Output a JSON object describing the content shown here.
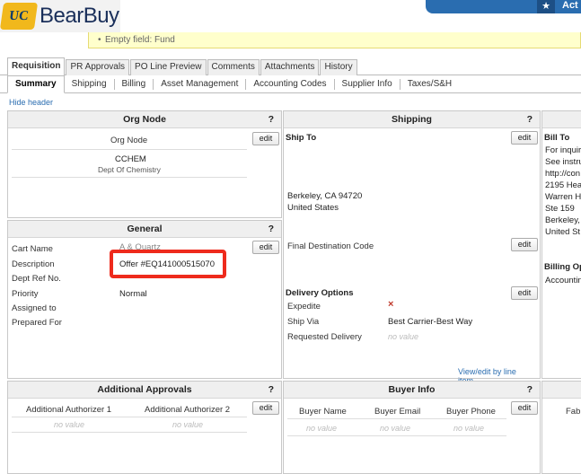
{
  "header": {
    "logo_badge": "UC",
    "brand": "BearBuy",
    "right_label": "Act",
    "star_icon": "star-icon"
  },
  "warning": {
    "message": "Empty field: Fund"
  },
  "tabs": [
    "Requisition",
    "PR Approvals",
    "PO Line Preview",
    "Comments",
    "Attachments",
    "History"
  ],
  "subtabs": [
    "Summary",
    "Shipping",
    "Billing",
    "Asset Management",
    "Accounting Codes",
    "Supplier Info",
    "Taxes/S&H"
  ],
  "hide_header": "Hide header",
  "org_node": {
    "title": "Org Node",
    "help": "?",
    "edit": "edit",
    "col_label": "Org Node",
    "code": "CCHEM",
    "name": "Dept Of Chemistry"
  },
  "shipping": {
    "title": "Shipping",
    "help": "?",
    "ship_to": "Ship To",
    "edit": "edit",
    "city": "Berkeley, CA 94720",
    "country": "United States",
    "final_dest_label": "Final Destination Code",
    "edit2": "edit",
    "delivery_options": "Delivery Options",
    "edit3": "edit",
    "expedite_label": "Expedite",
    "expedite_value": "×",
    "ship_via_label": "Ship Via",
    "ship_via_value": "Best Carrier-Best Way",
    "requested_delivery_label": "Requested Delivery",
    "requested_delivery_value": "no value",
    "line_link": "View/edit by line item..."
  },
  "bill_to": {
    "title": "Bill To",
    "lines": [
      "For inquir",
      "See instru",
      "http://con",
      "2195 Hea",
      "Warren H",
      "Ste 159",
      "Berkeley,",
      "United St"
    ],
    "billing_opt": "Billing Op",
    "accounting": "Accountin"
  },
  "general": {
    "title": "General",
    "help": "?",
    "edit": "edit",
    "cart_name_label": "Cart Name",
    "cart_name_value": "A & Quartz",
    "description_label": "Description",
    "description_value": "Offer #EQ141000515070",
    "dept_ref_label": "Dept Ref No.",
    "priority_label": "Priority",
    "priority_value": "Normal",
    "assigned_to_label": "Assigned to",
    "prepared_for_label": "Prepared For"
  },
  "additional_approvals": {
    "title": "Additional Approvals",
    "help": "?",
    "edit": "edit",
    "col1": "Additional Authorizer 1",
    "col2": "Additional Authorizer 2",
    "val1": "no value",
    "val2": "no value"
  },
  "buyer_info": {
    "title": "Buyer Info",
    "help": "?",
    "edit": "edit",
    "col1": "Buyer Name",
    "col2": "Buyer Email",
    "col3": "Buyer Phone",
    "val1": "no value",
    "val2": "no value",
    "val3": "no value"
  },
  "right_bottom": {
    "label": "Fabr"
  },
  "colors": {
    "accent": "#2a6db0",
    "highlight": "#ee2a1c",
    "warning_bg": "#ffffcc"
  }
}
